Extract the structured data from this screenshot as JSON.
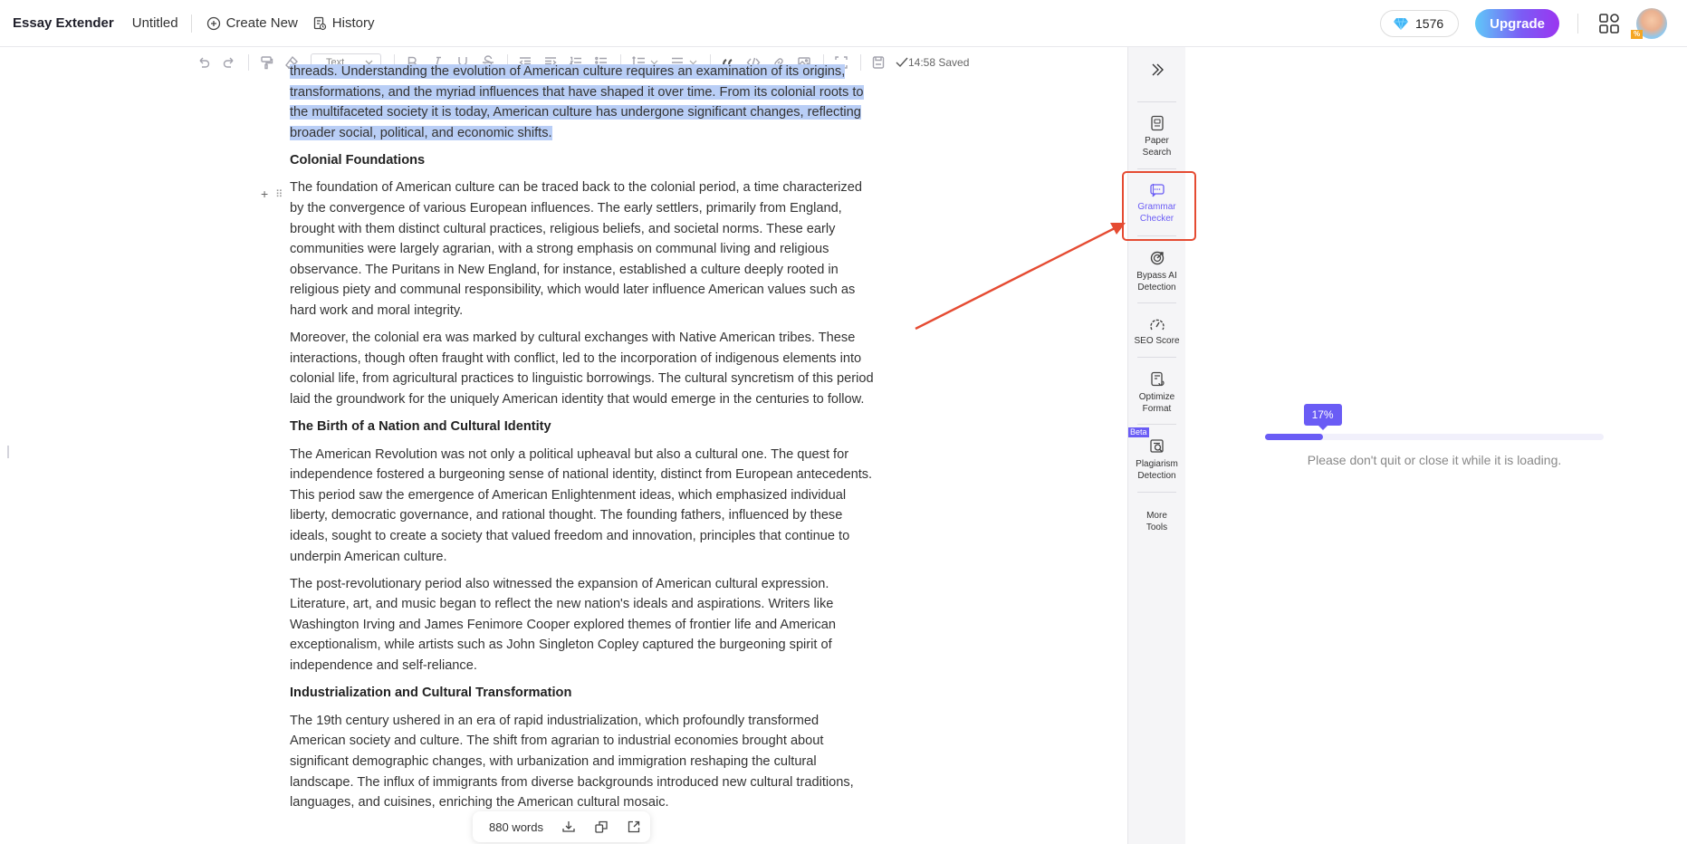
{
  "header": {
    "brand": "Essay Extender",
    "doc_title": "Untitled",
    "create_new": "Create New",
    "history": "History",
    "credits": "1576",
    "upgrade": "Upgrade",
    "avatar_badge": "%"
  },
  "toolbar": {
    "text_style": "Text",
    "saved_status": "14:58 Saved",
    "icons": [
      "undo-icon",
      "redo-icon",
      "format-painter-icon",
      "eraser-icon",
      "bold-icon",
      "italic-icon",
      "underline-icon",
      "strikethrough-icon",
      "outdent-icon",
      "indent-icon",
      "ordered-list-icon",
      "bullet-list-icon",
      "line-height-icon",
      "align-icon",
      "quote-icon",
      "code-icon",
      "link-icon",
      "image-icon",
      "fullscreen-icon",
      "save-icon"
    ]
  },
  "editor": {
    "intro_lines": [
      "threads. Understanding the evolution of American culture requires an examination of its origins,",
      "transformations, and the myriad influences that have shaped it over time. From its colonial roots to",
      "the multifaceted society it is today, American culture has undergone significant changes, reflecting",
      "broader social, political, and economic shifts."
    ],
    "sections": [
      {
        "heading": "Colonial Foundations",
        "paragraphs": [
          "The foundation of American culture can be traced back to the colonial period, a time characterized by the convergence of various European influences. The early settlers, primarily from England, brought with them distinct cultural practices, religious beliefs, and societal norms. These early communities were largely agrarian, with a strong emphasis on communal living and religious observance. The Puritans in New England, for instance, established a culture deeply rooted in religious piety and communal responsibility, which would later influence American values such as hard work and moral integrity.",
          "Moreover, the colonial era was marked by cultural exchanges with Native American tribes. These interactions, though often fraught with conflict, led to the incorporation of indigenous elements into colonial life, from agricultural practices to linguistic borrowings. The cultural syncretism of this period laid the groundwork for the uniquely American identity that would emerge in the centuries to follow."
        ]
      },
      {
        "heading": "The Birth of a Nation and Cultural Identity",
        "paragraphs": [
          "The American Revolution was not only a political upheaval but also a cultural one. The quest for independence fostered a burgeoning sense of national identity, distinct from European antecedents. This period saw the emergence of American Enlightenment ideas, which emphasized individual liberty, democratic governance, and rational thought. The founding fathers, influenced by these ideals, sought to create a society that valued freedom and innovation, principles that continue to underpin American culture.",
          "The post-revolutionary period also witnessed the expansion of American cultural expression. Literature, art, and music began to reflect the new nation's ideals and aspirations. Writers like Washington Irving and James Fenimore Cooper explored themes of frontier life and American exceptionalism, while artists such as John Singleton Copley captured the burgeoning spirit of independence and self-reliance."
        ]
      },
      {
        "heading": "Industrialization and Cultural Transformation",
        "paragraphs": [
          "The 19th century ushered in an era of rapid industrialization, which profoundly transformed American society and culture. The shift from agrarian to industrial economies brought about significant demographic changes, with urbanization and immigration reshaping the cultural landscape. The influx of immigrants from diverse backgrounds introduced new cultural traditions, languages, and cuisines, enriching the American cultural mosaic."
        ]
      }
    ]
  },
  "word_count": "880 words",
  "tools": {
    "items": [
      {
        "label1": "Paper",
        "label2": "Search",
        "icon": "paper-search-icon"
      },
      {
        "label1": "Grammar",
        "label2": "Checker",
        "icon": "grammar-checker-icon",
        "active": true
      },
      {
        "label1": "Bypass AI",
        "label2": "Detection",
        "icon": "bypass-ai-icon"
      },
      {
        "label1": "SEO Score",
        "label2": "",
        "icon": "seo-score-icon"
      },
      {
        "label1": "Optimize",
        "label2": "Format",
        "icon": "optimize-format-icon"
      },
      {
        "label1": "Plagiarism",
        "label2": "Detection",
        "icon": "plagiarism-icon"
      },
      {
        "label1": "More",
        "label2": "Tools",
        "icon": ""
      }
    ],
    "beta_label": "Beta"
  },
  "progress": {
    "percent": 17,
    "percent_label": "17%",
    "message": "Please don't quit or close it while it is loading."
  },
  "colors": {
    "accent": "#6a5cf5",
    "annotation": "#e54b32",
    "selection": "#b9cef6"
  }
}
